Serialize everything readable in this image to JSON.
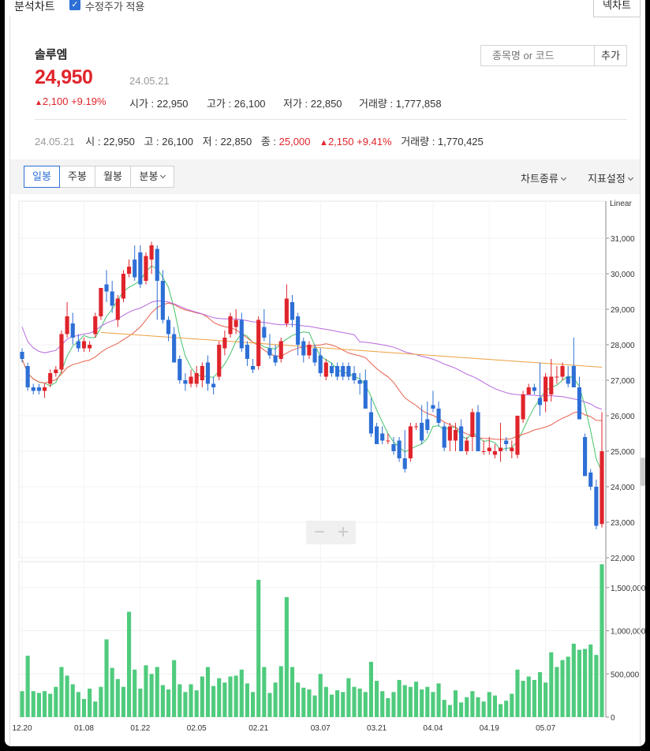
{
  "window": {
    "title": "분석차트",
    "checkbox_label": "수정주가 적용",
    "right_button": "넥차트"
  },
  "stock": {
    "name": "솔루엠",
    "price": "24,950",
    "date": "24.05.21",
    "change": "2,100",
    "change_pct": "+9.19%",
    "open_label": "시가",
    "open": "22,950",
    "high_label": "고가",
    "high": "26,100",
    "low_label": "저가",
    "low": "22,850",
    "volume_label": "거래량",
    "volume": "1,777,858"
  },
  "search": {
    "placeholder": "종목명 or 코드",
    "add_label": "추가"
  },
  "ohlc_line": {
    "date": "24.05.21",
    "o_label": "시",
    "o": "22,950",
    "h_label": "고",
    "h": "26,100",
    "l_label": "저",
    "l": "22,850",
    "c_label": "종",
    "c": "25,000",
    "chg": "2,150",
    "chg_pct": "+9.41%",
    "v_label": "거래량",
    "v": "1,770,425"
  },
  "tabs": [
    "일봉",
    "주봉",
    "월봉",
    "분봉"
  ],
  "menus": {
    "chart_type": "차트종류",
    "indicators": "지표설정"
  },
  "colors": {
    "up": "#e0242b",
    "down": "#2d6fd6",
    "volume": "#4fcb7d",
    "ma5": "#45c26a",
    "ma20": "#e8604c",
    "ma60": "#b868dd",
    "ma120": "#f0a040"
  },
  "chart_data": {
    "type": "candlestick",
    "scale_label": "Linear",
    "price_ylim": [
      22000,
      32000
    ],
    "price_ticks": [
      "31,000",
      "30,000",
      "29,000",
      "28,000",
      "27,000",
      "26,000",
      "25,000",
      "24,000",
      "23,000",
      "22,000"
    ],
    "volume_ylim": [
      0,
      1800000
    ],
    "volume_ticks": [
      "1,500,000",
      "1,000,000",
      "500,000",
      "0"
    ],
    "x_labels": [
      {
        "index": 0,
        "label": "12.20"
      },
      {
        "index": 11,
        "label": "01.08"
      },
      {
        "index": 21,
        "label": "01.22"
      },
      {
        "index": 31,
        "label": "02.05"
      },
      {
        "index": 42,
        "label": "02.21"
      },
      {
        "index": 53,
        "label": "03.07"
      },
      {
        "index": 63,
        "label": "03.21"
      },
      {
        "index": 73,
        "label": "04.04"
      },
      {
        "index": 83,
        "label": "04.19"
      },
      {
        "index": 93,
        "label": "05.07"
      }
    ],
    "candles": [
      [
        27800,
        27900,
        27500,
        27600,
        300000
      ],
      [
        27400,
        27500,
        26700,
        26800,
        710000
      ],
      [
        26800,
        26900,
        26600,
        26700,
        300000
      ],
      [
        26800,
        26900,
        26600,
        26700,
        280000
      ],
      [
        26700,
        26900,
        26500,
        26800,
        300000
      ],
      [
        26900,
        27300,
        26800,
        27200,
        270000
      ],
      [
        27200,
        27400,
        27100,
        27300,
        350000
      ],
      [
        27300,
        28400,
        27200,
        28300,
        580000
      ],
      [
        28300,
        29200,
        28200,
        28800,
        480000
      ],
      [
        28600,
        28900,
        28000,
        28200,
        380000
      ],
      [
        28100,
        28300,
        27800,
        27900,
        290000
      ],
      [
        27900,
        28200,
        27800,
        28100,
        210000
      ],
      [
        27900,
        28100,
        27800,
        28000,
        330000
      ],
      [
        28300,
        28900,
        28200,
        28800,
        180000
      ],
      [
        28800,
        29600,
        28700,
        29600,
        350000
      ],
      [
        29700,
        30100,
        29200,
        29500,
        900000
      ],
      [
        29500,
        29800,
        28900,
        29100,
        570000
      ],
      [
        28700,
        29400,
        28500,
        29300,
        440000
      ],
      [
        29300,
        30100,
        29200,
        30000,
        350000
      ],
      [
        30000,
        30400,
        29900,
        30200,
        1220000
      ],
      [
        30400,
        30800,
        29800,
        29900,
        550000
      ],
      [
        30600,
        30800,
        29600,
        29700,
        330000
      ],
      [
        29800,
        30600,
        29700,
        30500,
        600000
      ],
      [
        30400,
        30900,
        30000,
        30800,
        500000
      ],
      [
        30700,
        30800,
        28700,
        29800,
        580000
      ],
      [
        29800,
        30100,
        28600,
        28700,
        370000
      ],
      [
        28700,
        28800,
        28100,
        28300,
        320000
      ],
      [
        28300,
        28500,
        27600,
        27500,
        660000
      ],
      [
        27600,
        27700,
        26900,
        27000,
        380000
      ],
      [
        27000,
        27200,
        26700,
        26900,
        290000
      ],
      [
        26900,
        27300,
        26800,
        27100,
        380000
      ],
      [
        26900,
        27400,
        26800,
        27200,
        310000
      ],
      [
        27000,
        27500,
        26800,
        27400,
        470000
      ],
      [
        27500,
        27700,
        26700,
        26900,
        580000
      ],
      [
        26900,
        27100,
        26600,
        26800,
        360000
      ],
      [
        27100,
        28100,
        27000,
        28000,
        450000
      ],
      [
        27900,
        28400,
        27700,
        28200,
        400000
      ],
      [
        28300,
        28900,
        28200,
        28800,
        470000
      ],
      [
        28500,
        29000,
        28300,
        28700,
        480000
      ],
      [
        28700,
        28900,
        27800,
        27900,
        550000
      ],
      [
        28000,
        28100,
        27400,
        27600,
        390000
      ],
      [
        27400,
        27600,
        27200,
        27300,
        290000
      ],
      [
        27400,
        28800,
        27300,
        28700,
        1590000
      ],
      [
        28500,
        29000,
        28100,
        28200,
        580000
      ],
      [
        27900,
        28300,
        27600,
        27700,
        280000
      ],
      [
        27700,
        28000,
        27400,
        27500,
        400000
      ],
      [
        27600,
        28200,
        27500,
        28100,
        590000
      ],
      [
        28600,
        29700,
        28500,
        29300,
        1390000
      ],
      [
        29200,
        29400,
        28500,
        28700,
        580000
      ],
      [
        28800,
        28900,
        27700,
        28000,
        400000
      ],
      [
        28100,
        28200,
        27500,
        27700,
        340000
      ],
      [
        27700,
        28100,
        27600,
        28000,
        320000
      ],
      [
        27900,
        28000,
        27400,
        27500,
        250000
      ],
      [
        27700,
        27900,
        27100,
        27200,
        500000
      ],
      [
        27100,
        27600,
        27000,
        27500,
        350000
      ],
      [
        27400,
        27500,
        27100,
        27200,
        260000
      ],
      [
        27400,
        27500,
        27000,
        27100,
        310000
      ],
      [
        27400,
        27500,
        27000,
        27100,
        290000
      ],
      [
        27400,
        27500,
        27000,
        27100,
        450000
      ],
      [
        27200,
        27400,
        26900,
        27000,
        350000
      ],
      [
        27000,
        27200,
        26600,
        26900,
        330000
      ],
      [
        27000,
        27300,
        26200,
        26200,
        290000
      ],
      [
        26100,
        26500,
        25400,
        25500,
        640000
      ],
      [
        25700,
        25800,
        25200,
        25200,
        420000
      ],
      [
        25500,
        25700,
        25200,
        25300,
        300000
      ],
      [
        25300,
        25500,
        25200,
        25300,
        220000
      ],
      [
        25200,
        25400,
        24900,
        25000,
        290000
      ],
      [
        25300,
        25400,
        24700,
        24800,
        430000
      ],
      [
        24800,
        25600,
        24400,
        24500,
        370000
      ],
      [
        24800,
        25800,
        24700,
        25700,
        350000
      ],
      [
        25700,
        25800,
        25600,
        25700,
        410000
      ],
      [
        25800,
        26300,
        25200,
        25300,
        320000
      ],
      [
        25900,
        26400,
        25500,
        25600,
        350000
      ],
      [
        26300,
        26700,
        26100,
        26200,
        290000
      ],
      [
        26200,
        26400,
        25700,
        25800,
        390000
      ],
      [
        25700,
        25800,
        25000,
        25100,
        200000
      ],
      [
        25300,
        25800,
        25000,
        25700,
        140000
      ],
      [
        25300,
        25800,
        25000,
        25600,
        310000
      ],
      [
        25700,
        25900,
        25000,
        25000,
        170000
      ],
      [
        25000,
        25400,
        24900,
        25300,
        230000
      ],
      [
        25400,
        26200,
        25000,
        26100,
        300000
      ],
      [
        26100,
        26300,
        25200,
        25000,
        230000
      ],
      [
        25000,
        25300,
        24900,
        25000,
        180000
      ],
      [
        25000,
        25400,
        24900,
        25100,
        290000
      ],
      [
        24900,
        25200,
        24800,
        25000,
        250000
      ],
      [
        25000,
        25800,
        24700,
        25100,
        150000
      ],
      [
        25300,
        25400,
        25000,
        25200,
        190000
      ],
      [
        25000,
        25300,
        24800,
        25100,
        270000
      ],
      [
        24900,
        26000,
        24800,
        26000,
        550000
      ],
      [
        25900,
        26700,
        25800,
        26600,
        420000
      ],
      [
        26600,
        26900,
        26600,
        26800,
        470000
      ],
      [
        26800,
        26900,
        26600,
        26700,
        430000
      ],
      [
        26500,
        27500,
        26000,
        26300,
        520000
      ],
      [
        26400,
        27200,
        26100,
        27100,
        400000
      ],
      [
        26600,
        27600,
        26400,
        27100,
        750000
      ],
      [
        27100,
        27400,
        26900,
        27100,
        580000
      ],
      [
        27100,
        27500,
        27000,
        27400,
        660000
      ],
      [
        27100,
        27400,
        26800,
        26900,
        700000
      ],
      [
        27400,
        28200,
        27100,
        26800,
        850000
      ],
      [
        26800,
        27100,
        25900,
        25900,
        780000
      ],
      [
        25400,
        25500,
        24300,
        24300,
        790000
      ],
      [
        24400,
        24500,
        23900,
        24000,
        840000
      ],
      [
        24000,
        24200,
        22800,
        22900,
        720000
      ],
      [
        22950,
        26100,
        22850,
        25000,
        1770425
      ]
    ],
    "ma_series": [
      {
        "name": "ma5",
        "color": "#45c26a"
      },
      {
        "name": "ma20",
        "color": "#e8604c"
      },
      {
        "name": "ma60",
        "color": "#b868dd"
      },
      {
        "name": "ma120",
        "color": "#f0a040"
      }
    ]
  }
}
